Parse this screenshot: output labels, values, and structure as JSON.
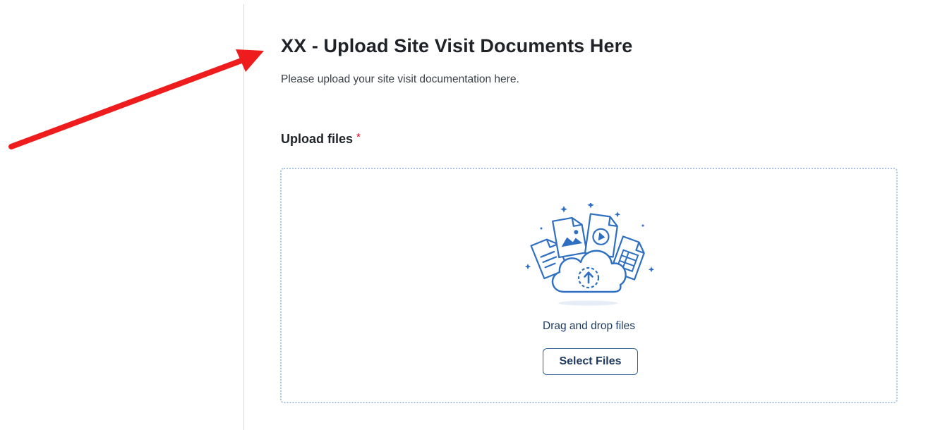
{
  "form": {
    "title": "XX - Upload Site Visit Documents Here",
    "description": "Please upload your site visit documentation here."
  },
  "upload_field": {
    "label": "Upload files",
    "required_marker": "*",
    "dropzone_text": "Drag and drop files",
    "select_button_label": "Select Files",
    "illustration_icon": "cloud-upload-files-icon"
  },
  "annotation": {
    "arrow_color": "#ee1c1c",
    "arrow_icon": "red-arrow-icon"
  },
  "colors": {
    "accent": "#2f6fc2",
    "dropzone_border": "#a9c3e3",
    "required": "#d0021b",
    "divider": "#d9d9d9"
  }
}
